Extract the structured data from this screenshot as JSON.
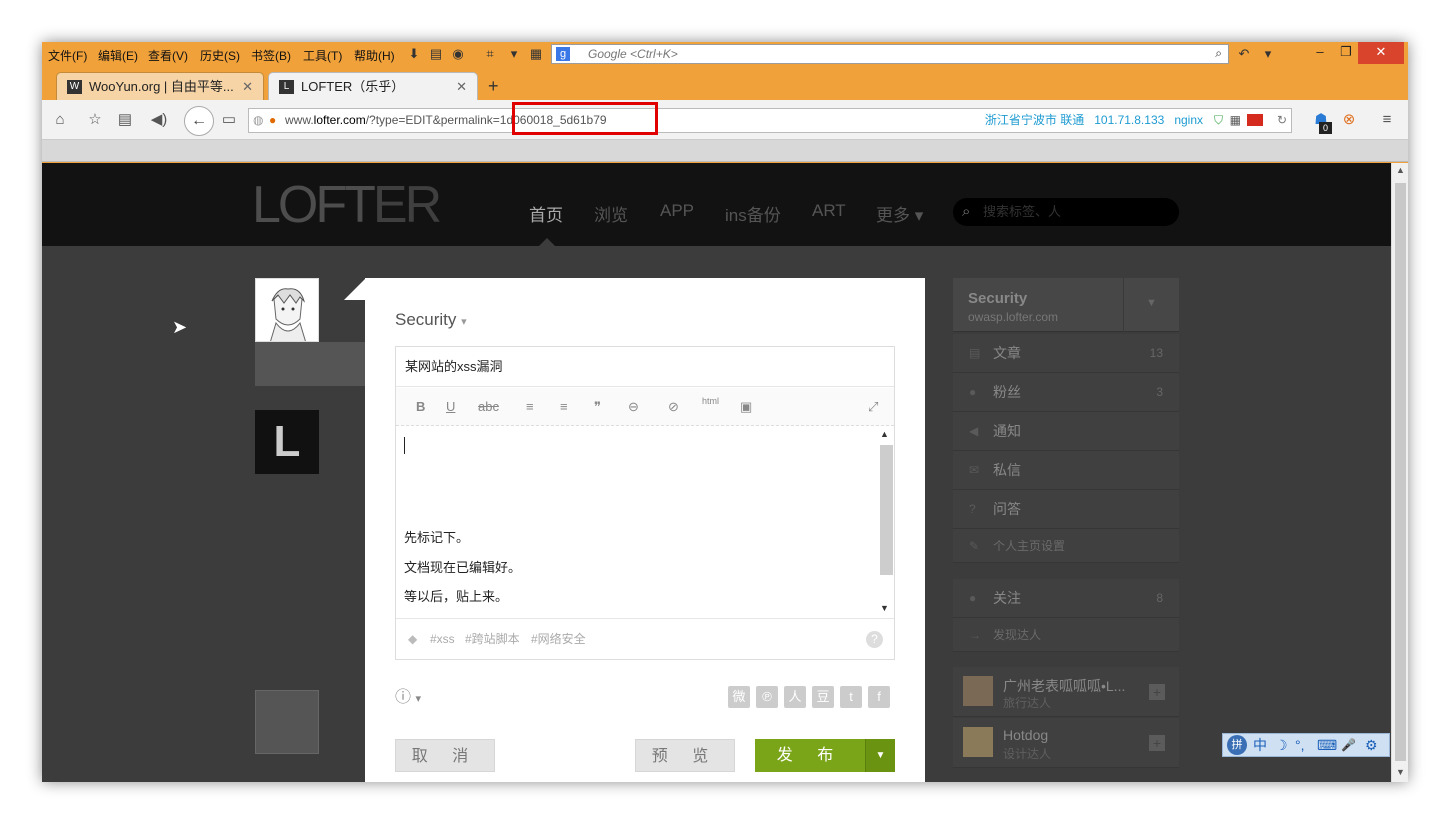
{
  "menu": [
    "文件(F)",
    "编辑(E)",
    "查看(V)",
    "历史(S)",
    "书签(B)",
    "工具(T)",
    "帮助(H)"
  ],
  "search": {
    "placeholder": "Google <Ctrl+K>"
  },
  "tabs": [
    {
      "title": "WooYun.org | 自由平等...",
      "icon": "wooyun-favicon"
    },
    {
      "title": "LOFTER（乐乎）",
      "icon": "lofter-favicon"
    }
  ],
  "address": {
    "url_prefix": "www.",
    "url_domain": "lofter.com",
    "url_rest": "/?type=EDIT&permalink=1d060018_5d61b79",
    "location": "浙江省宁波市 联通",
    "ip": "101.71.8.133",
    "server": "nginx",
    "badge": "0"
  },
  "site": {
    "logo_a": "LOFT",
    "logo_b": "ER",
    "nav": [
      "首页",
      "浏览",
      "APP",
      "ins备份",
      "ART",
      "更多 ▾"
    ],
    "search_placeholder": "搜索标签、人"
  },
  "editor": {
    "blog": "Security",
    "title": "某网站的xss漏洞",
    "lines": [
      "先标记下。",
      "文档现在已编辑好。",
      "等以后，贴上来。"
    ],
    "tags": [
      "#xss",
      "#跨站脚本",
      "#网络安全"
    ],
    "toolbar": [
      "B",
      "U",
      "abc",
      "≡",
      "≡",
      "❞",
      "⊖",
      "⊘",
      "html",
      "▣"
    ],
    "cancel": "取 消",
    "preview": "预 览",
    "publish": "发 布"
  },
  "sidebar": {
    "name": "Security",
    "domain": "owasp.lofter.com",
    "items": [
      {
        "label": "文章",
        "count": "13"
      },
      {
        "label": "粉丝",
        "count": "3"
      },
      {
        "label": "通知",
        "count": ""
      },
      {
        "label": "私信",
        "count": ""
      },
      {
        "label": "问答",
        "count": ""
      }
    ],
    "settings": "个人主页设置",
    "follow": {
      "label": "关注",
      "count": "8"
    },
    "discover": "发现达人",
    "recommend": [
      {
        "name": "广州老表呱呱呱•L...",
        "sub": "旅行达人"
      },
      {
        "name": "Hotdog",
        "sub": "设计达人"
      }
    ]
  },
  "ime": [
    "中",
    "☽",
    "°,",
    "⌨",
    "🎤",
    "⚙"
  ]
}
